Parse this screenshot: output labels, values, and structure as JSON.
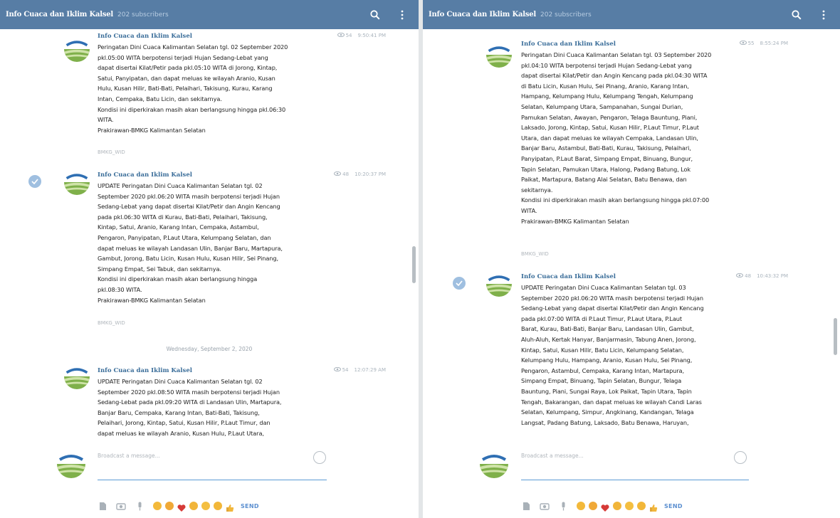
{
  "left": {
    "header": {
      "title": "Info Cuaca dan Iklim Kalsel",
      "subs": "202 subscribers"
    },
    "messages": [
      {
        "author": "Info Cuaca dan Iklim Kalsel",
        "views": "54",
        "time": "9:50:41 PM",
        "body": "Peringatan Dini Cuaca Kalimantan Selatan tgl. 02 September 2020\npkl.05:00 WITA berpotensi terjadi Hujan Sedang-Lebat yang\ndapat disertai Kilat/Petir pada pkl.05:10 WITA di Jorong, Kintap,\nSatui, Panyipatan, dan dapat meluas ke wilayah Aranio, Kusan\nHulu, Kusan Hilir, Bati-Bati, Pelaihari, Takisung, Kurau, Karang\nIntan, Cempaka, Batu Licin, dan sekitarnya.\nKondisi ini diperkirakan masih akan berlangsung hingga pkl.06:30\nWITA.\nPrakirawan-BMKG Kalimantan Selatan",
        "signature": "BMKG_WID"
      },
      {
        "author": "Info Cuaca dan Iklim Kalsel",
        "views": "48",
        "time": "10:20:37 PM",
        "body": "UPDATE Peringatan Dini Cuaca Kalimantan Selatan tgl. 02\nSeptember 2020 pkl.06:20 WITA masih berpotensi terjadi Hujan\nSedang-Lebat yang dapat disertai Kilat/Petir dan Angin Kencang\npada pkl.06:30 WITA di Kurau, Bati-Bati, Pelaihari, Takisung,\nKintap, Satui, Aranio, Karang Intan, Cempaka, Astambul,\nPengaron, Panyipatan, P.Laut Utara, Kelumpang Selatan, dan\ndapat meluas ke wilayah Landasan Ulin, Banjar Baru, Martapura,\nGambut, Jorong, Batu Licin, Kusan Hulu, Kusan Hilir, Sei Pinang,\nSimpang Empat, Sei Tabuk, dan sekitarnya.\nKondisi ini diperkirakan masih akan berlangsung hingga\npkl.08:30 WITA.\nPrakirawan-BMKG Kalimantan Selatan",
        "signature": "BMKG_WID"
      },
      {
        "author": "Info Cuaca dan Iklim Kalsel",
        "views": "54",
        "time": "12:07:29 AM",
        "body": "UPDATE Peringatan Dini Cuaca Kalimantan Selatan tgl. 02\nSeptember 2020 pkl.08:50 WITA masih berpotensi terjadi Hujan\nSedang-Lebat pada pkl.09:20 WITA di Landasan Ulin, Martapura,\nBanjar Baru, Cempaka, Karang Intan, Bati-Bati, Takisung,\nPelaihari, Jorong, Kintap, Satui, Kusan Hilir, P.Laut Timur, dan\ndapat meluas ke wilayah Aranio, Kusan Hulu, P.Laut Utara,"
      }
    ],
    "date_separator": "Wednesday, September 2, 2020",
    "composer": {
      "placeholder": "Broadcast a message...",
      "send": "SEND"
    }
  },
  "right": {
    "header": {
      "title": "Info Cuaca dan Iklim Kalsel",
      "subs": "202 subscribers"
    },
    "messages": [
      {
        "author": "Info Cuaca dan Iklim Kalsel",
        "views": "55",
        "time": "8:55:24 PM",
        "body": "Peringatan Dini Cuaca Kalimantan Selatan tgl. 03 September 2020\npkl.04:10 WITA berpotensi terjadi Hujan Sedang-Lebat yang\ndapat disertai Kilat/Petir dan Angin Kencang pada pkl.04:30 WITA\ndi Batu Licin, Kusan Hulu, Sei Pinang, Aranio, Karang Intan,\nHampang, Kelumpang Hulu, Kelumpang Tengah, Kelumpang\nSelatan, Kelumpang Utara, Sampanahan, Sungai Durian,\nPamukan Selatan, Awayan, Pengaron, Telaga Bauntung, Piani,\nLaksado, Jorong, Kintap, Satui, Kusan Hilir, P.Laut Timur, P.Laut\nUtara, dan dapat meluas ke wilayah Cempaka, Landasan Ulin,\nBanjar Baru, Astambul, Bati-Bati, Kurau, Takisung, Pelaihari,\nPanyipatan, P.Laut Barat, Simpang Empat, Binuang, Bungur,\nTapin Selatan, Pamukan Utara, Halong, Padang Batung, Lok\nPaikat, Martapura, Batang Alai Selatan, Batu Benawa, dan\nsekitarnya.\nKondisi ini diperkirakan masih akan berlangsung hingga pkl.07:00\nWITA.\nPrakirawan-BMKG Kalimantan Selatan",
        "signature": "BMKG_WID"
      },
      {
        "author": "Info Cuaca dan Iklim Kalsel",
        "views": "48",
        "time": "10:43:32 PM",
        "body": "UPDATE Peringatan Dini Cuaca Kalimantan Selatan tgl. 03\nSeptember 2020 pkl.06:20 WITA masih berpotensi terjadi Hujan\nSedang-Lebat yang dapat disertai Kilat/Petir dan Angin Kencang\npada pkl.07:00 WITA di P.Laut Timur, P.Laut Utara, P.Laut\nBarat, Kurau, Bati-Bati, Banjar Baru, Landasan Ulin, Gambut,\nAluh-Aluh, Kertak Hanyar, Banjarmasin, Tabung Anen, Jorong,\nKintap, Satui, Kusan Hilir, Batu Licin, Kelumpang Selatan,\nKelumpang Hulu, Hampang, Aranio, Kusan Hulu, Sei Pinang,\nPengaron, Astambul, Cempaka, Karang Intan, Martapura,\nSimpang Empat, Binuang, Tapin Selatan, Bungur, Telaga\nBauntung, Piani, Sungai Raya, Lok Paikat, Tapin Utara, Tapin\nTengah, Bakarangan, dan dapat meluas ke wilayah Candi Laras\nSelatan, Kelumpang, Simpur, Angkinang, Kandangan, Telaga\nLangsat, Padang Batung, Laksado, Batu Benawa, Haruyan,"
      }
    ],
    "composer": {
      "placeholder": "Broadcast a message...",
      "send": "SEND"
    }
  },
  "icons": {
    "search": "search-icon",
    "more": "more-vertical-icon",
    "smiley": "smiley-icon",
    "attach": "attach-file-icon",
    "camera": "camera-icon",
    "mic": "microphone-icon"
  },
  "colors": {
    "header": "#577da5",
    "author": "#3a6d99",
    "send": "#5b8fd0"
  }
}
